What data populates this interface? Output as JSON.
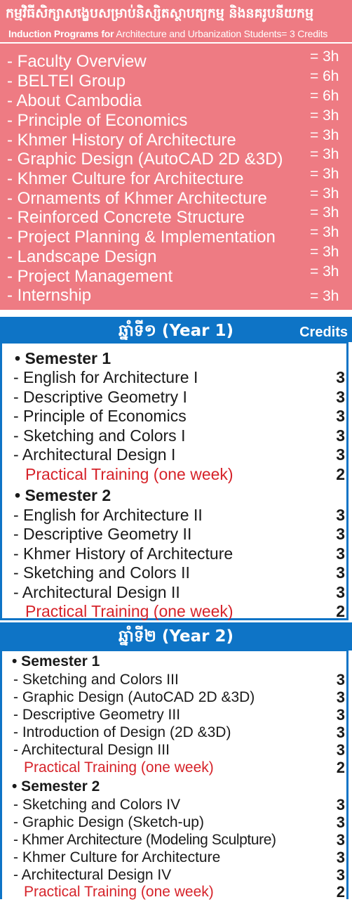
{
  "induction": {
    "title_khmer": "កម្មវិធីសិក្សាសង្ខេបសម្រាប់និស្សិតស្ថាបត្យកម្ម និងនគរូបនីយកម្ម",
    "subtitle_bold": "Induction Programs for",
    "subtitle_rest": "Architecture and Urbanization Students= 3 Credits",
    "items": [
      {
        "name": "- Faculty Overview",
        "hours": "= 3h"
      },
      {
        "name": "- BELTEI Group",
        "hours": "= 6h"
      },
      {
        "name": "- About Cambodia",
        "hours": "= 6h"
      },
      {
        "name": "- Principle of Economics",
        "hours": "= 3h"
      },
      {
        "name": "- Khmer History of Architecture",
        "hours": "= 3h"
      },
      {
        "name": "- Graphic Design (AutoCAD 2D &3D)",
        "hours": "= 3h"
      },
      {
        "name": "- Khmer Culture for Architecture",
        "hours": "= 3h"
      },
      {
        "name": "- Ornaments of Khmer Architecture",
        "hours": "= 3h"
      },
      {
        "name": "- Reinforced Concrete Structure",
        "hours": "= 3h"
      },
      {
        "name": "- Project Planning & Implementation",
        "hours": "= 3h"
      },
      {
        "name": "- Landscape Design",
        "hours": "= 3h"
      },
      {
        "name": "- Project Management",
        "hours": "= 3h"
      },
      {
        "name": "- Internship",
        "hours": "= 3h"
      }
    ]
  },
  "year1": {
    "title": "ឆ្នាំទី១ (Year 1)",
    "credits_label": "Credits",
    "semester1": {
      "label": "• Semester 1",
      "courses": [
        {
          "name": "- English for Architecture I",
          "credits": "3"
        },
        {
          "name": "- Descriptive Geometry I",
          "credits": "3"
        },
        {
          "name": "- Principle of Economics",
          "credits": "3"
        },
        {
          "name": "- Sketching and Colors I",
          "credits": "3"
        },
        {
          "name": "- Architectural Design I",
          "credits": "3"
        }
      ],
      "practical": {
        "name": "Practical Training (one week)",
        "credits": "2"
      }
    },
    "semester2": {
      "label": "• Semester 2",
      "courses": [
        {
          "name": "- English for Architecture II",
          "credits": "3"
        },
        {
          "name": "- Descriptive Geometry II",
          "credits": "3"
        },
        {
          "name": "- Khmer History of Architecture",
          "credits": "3"
        },
        {
          "name": "- Sketching and Colors II",
          "credits": "3"
        },
        {
          "name": "- Architectural Design II",
          "credits": "3"
        }
      ],
      "practical": {
        "name": "Practical Training (one week)",
        "credits": "2"
      }
    }
  },
  "year2": {
    "title": "ឆ្នាំទី២ (Year 2)",
    "semester1": {
      "label": "• Semester 1",
      "courses": [
        {
          "name": "- Sketching and Colors III",
          "credits": "3"
        },
        {
          "name": "- Graphic Design (AutoCAD 2D &3D)",
          "credits": "3"
        },
        {
          "name": "- Descriptive Geometry III",
          "credits": "3"
        },
        {
          "name": "- Introduction of Design (2D &3D)",
          "credits": "3"
        },
        {
          "name": "- Architectural Design III",
          "credits": "3"
        }
      ],
      "practical": {
        "name": "Practical Training (one week)",
        "credits": "2"
      }
    },
    "semester2": {
      "label": "• Semester 2",
      "courses": [
        {
          "name": "- Sketching and Colors IV",
          "credits": "3"
        },
        {
          "name": "- Graphic Design (Sketch-up)",
          "credits": "3"
        },
        {
          "name": "- Khmer Architecture (Modeling Sculpture)",
          "credits": "3"
        },
        {
          "name": "- Khmer Culture for Architecture",
          "credits": "3"
        },
        {
          "name": "- Architectural Design IV",
          "credits": "3"
        }
      ],
      "practical": {
        "name": "Practical Training (one week)",
        "credits": "2"
      }
    }
  },
  "colors": {
    "induction_bg": "#ee7b83",
    "year_blue": "#0e74c6",
    "practical_red": "#d6232a"
  }
}
